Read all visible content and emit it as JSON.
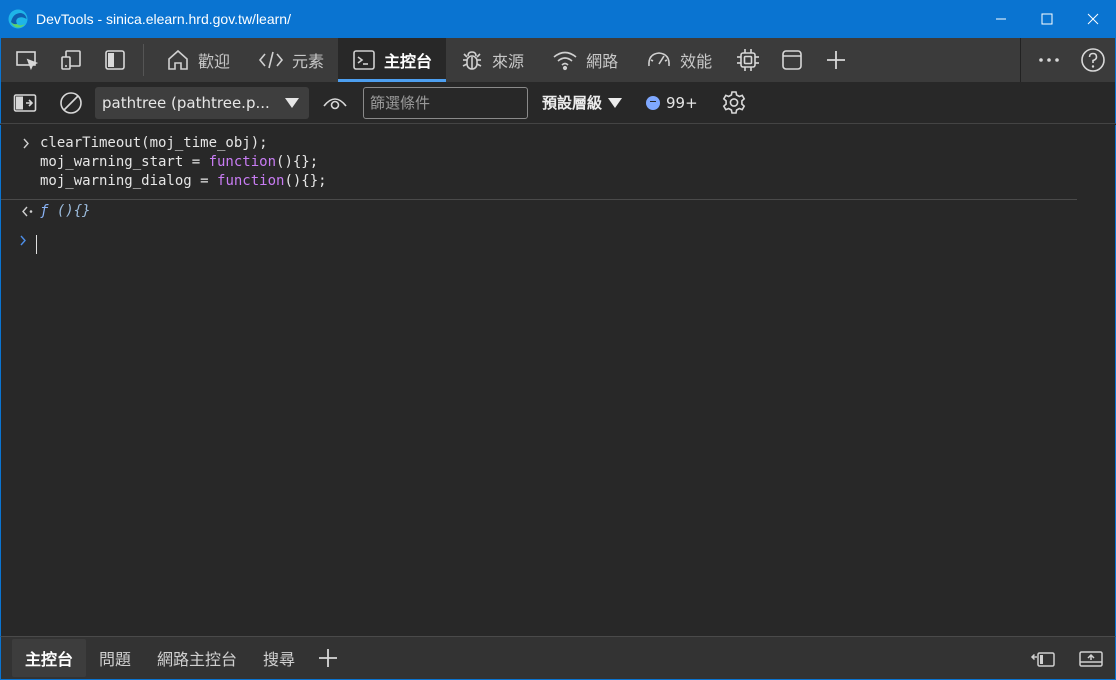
{
  "window": {
    "title": "DevTools - sinica.elearn.hrd.gov.tw/learn/"
  },
  "tabs": [
    {
      "label": "歡迎",
      "icon": "home-icon"
    },
    {
      "label": "元素",
      "icon": "code-icon"
    },
    {
      "label": "主控台",
      "icon": "console-icon",
      "active": true
    },
    {
      "label": "來源",
      "icon": "bug-icon"
    },
    {
      "label": "網路",
      "icon": "wifi-icon"
    },
    {
      "label": "效能",
      "icon": "gauge-icon"
    }
  ],
  "toolbar": {
    "context_value": "pathtree (pathtree.p...",
    "filter_placeholder": "篩選條件",
    "levels_label": "預設層級",
    "issues_count": "99+"
  },
  "console": {
    "input_lines": [
      {
        "plain_before": "clearTimeout(moj_time_obj);",
        "keyword": "",
        "plain_after": ""
      },
      {
        "plain_before": "moj_warning_start = ",
        "keyword": "function",
        "plain_after": "(){};"
      },
      {
        "plain_before": "moj_warning_dialog = ",
        "keyword": "function",
        "plain_after": "(){};"
      }
    ],
    "result_f": "ƒ",
    "result_text": " (){}"
  },
  "drawer": {
    "tabs": [
      "主控台",
      "問題",
      "網路主控台",
      "搜尋"
    ]
  },
  "colors": {
    "titlebar": "#0a74d1",
    "active_tab_indicator": "#4d9ff0",
    "keyword": "#c87cf3"
  }
}
